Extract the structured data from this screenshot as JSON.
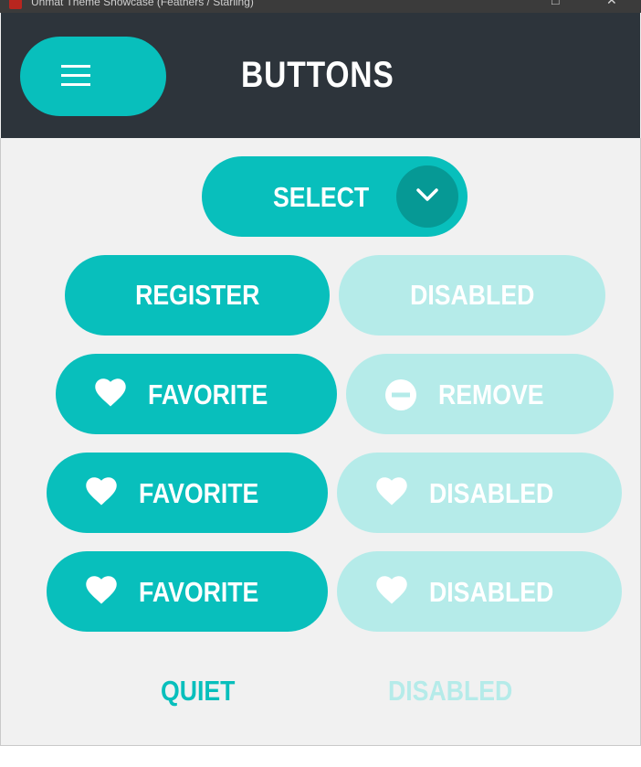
{
  "window": {
    "title": "Uhmat Theme Showcase (Feathers / Starling)"
  },
  "header": {
    "title": "BUTTONS",
    "menu_icon": "hamburger-menu-icon"
  },
  "buttons": {
    "select": "SELECT",
    "register": "REGISTER",
    "disabled_1": "DISABLED",
    "favorite_1": "FAVORITE",
    "remove": "REMOVE",
    "favorite_2": "FAVORITE",
    "disabled_2": "DISABLED",
    "favorite_3": "FAVORITE",
    "disabled_3": "DISABLED",
    "quiet": "QUIET",
    "quiet_disabled": "DISABLED"
  },
  "colors": {
    "accent": "#08bfbc",
    "accent_dark": "#069995",
    "accent_disabled": "#b5ebe9",
    "header_bg": "#2d343b",
    "background": "#f1f1f1"
  }
}
